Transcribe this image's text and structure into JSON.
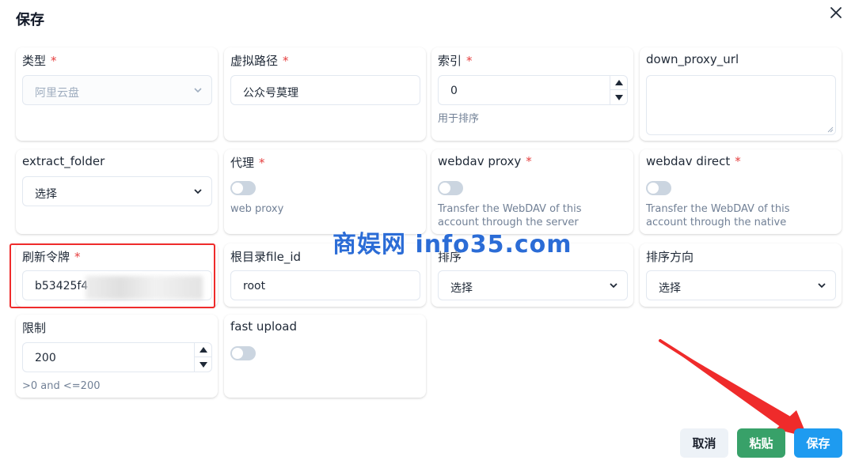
{
  "dialog": {
    "title": "保存"
  },
  "fields": {
    "type": {
      "label": "类型",
      "required": "*",
      "value": "阿里云盘"
    },
    "virtual_path": {
      "label": "虚拟路径",
      "required": "*",
      "value": "公众号莫理"
    },
    "index": {
      "label": "索引",
      "required": "*",
      "value": "0",
      "helper": "用于排序"
    },
    "down_proxy_url": {
      "label": "down_proxy_url",
      "value": ""
    },
    "extract_folder": {
      "label": "extract_folder",
      "value": "选择"
    },
    "proxy": {
      "label": "代理",
      "required": "*",
      "helper": "web proxy",
      "enabled": false
    },
    "webdav_proxy": {
      "label": "webdav proxy",
      "required": "*",
      "helper": "Transfer the WebDAV of this account through the server",
      "enabled": false
    },
    "webdav_direct": {
      "label": "webdav direct",
      "required": "*",
      "helper": "Transfer the WebDAV of this account through the native",
      "enabled": false
    },
    "refresh_token": {
      "label": "刷新令牌",
      "required": "*",
      "value": "b53425f4"
    },
    "root_folder_file_id": {
      "label": "根目录file_id",
      "value": "root"
    },
    "order_by": {
      "label": "排序",
      "value": "选择"
    },
    "order_direction": {
      "label": "排序方向",
      "value": "选择"
    },
    "limit": {
      "label": "限制",
      "value": "200",
      "helper": ">0 and <=200"
    },
    "fast_upload": {
      "label": "fast upload",
      "enabled": false
    }
  },
  "footer": {
    "cancel_label": "取消",
    "paste_label": "粘贴",
    "save_label": "保存"
  },
  "watermark": "商娱网 info35.com",
  "colors": {
    "primary": "#1e9bf0",
    "success": "#38a169",
    "required": "#e53e3e",
    "highlight": "#ef2b2b"
  }
}
